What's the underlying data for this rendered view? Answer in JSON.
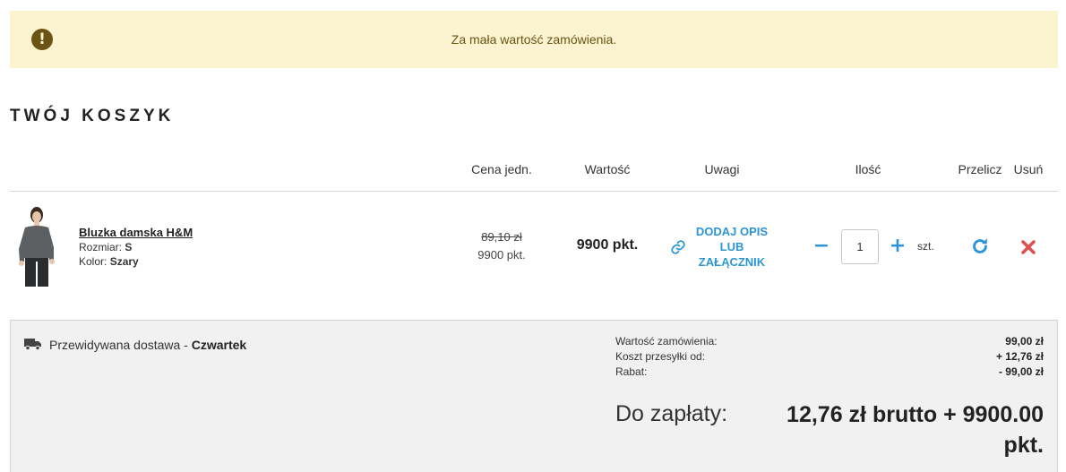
{
  "alert": {
    "message": "Za mała wartość zamówienia.",
    "icon": "exclamation-circle-icon",
    "color": "#6b5313",
    "bg": "#fcf3d0"
  },
  "page_title": "TWÓJ KOSZYK",
  "columns": {
    "unit_price": "Cena jedn.",
    "value": "Wartość",
    "remarks": "Uwagi",
    "quantity": "Ilość",
    "recalculate": "Przelicz",
    "remove": "Usuń"
  },
  "item": {
    "name": "Bluzka damska H&M",
    "size_label": "Rozmiar:",
    "size": "S",
    "color_label": "Kolor:",
    "color": "Szary",
    "old_price": "89,10 zł",
    "unit_points": "9900 pkt.",
    "value": "9900 pkt.",
    "remark_link": "DODAJ OPIS LUB ZAŁĄCZNIK",
    "quantity": "1",
    "unit": "szt."
  },
  "summary": {
    "delivery_label": "Przewidywana dostawa -",
    "delivery_day": "Czwartek",
    "order_value_label": "Wartość zamówienia:",
    "order_value": "99,00 zł",
    "shipping_label": "Koszt przesyłki od:",
    "shipping": "+ 12,76 zł",
    "discount_label": "Rabat:",
    "discount": "- 99,00 zł",
    "to_pay_label": "Do zapłaty:",
    "to_pay": "12,76 zł brutto + 9900.00 pkt."
  },
  "colors": {
    "accent": "#2b95d6",
    "remove": "#e05252",
    "summary_bg": "#f1f1f1"
  }
}
